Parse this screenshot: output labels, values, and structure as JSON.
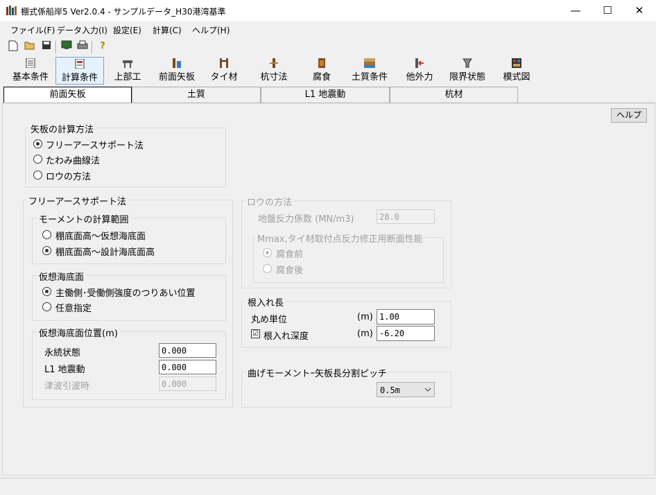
{
  "window": {
    "title": "棚式係船岸5 Ver2.0.4 - サンプルデータ_H30港湾基準",
    "minimize": "—",
    "maximize": "☐",
    "close": "✕"
  },
  "menu": [
    "ファイル(F)",
    "データ入力(I)",
    "設定(E)",
    "計算(C)",
    "ヘルプ(H)"
  ],
  "big_toolbar": [
    "基本条件",
    "計算条件",
    "上部工",
    "前面矢板",
    "タイ材",
    "杭寸法",
    "腐食",
    "土質条件",
    "他外力",
    "限界状態",
    "模式図"
  ],
  "tabs": [
    "前面矢板",
    "土質",
    "L1 地震動",
    "杭材"
  ],
  "help_button": "ヘルプ",
  "calc_method": {
    "legend": "矢板の計算方法",
    "options": [
      "フリーアースサポート法",
      "たわみ曲線法",
      "ロウの方法"
    ],
    "selected": 0
  },
  "free_earth": {
    "legend": "フリーアースサポート法",
    "moment_range": {
      "legend": "モーメントの計算範囲",
      "options": [
        "棚底面高～仮想海底面",
        "棚底面高～設計海底面高"
      ],
      "selected": 1
    },
    "virtual_seabed": {
      "legend": "仮想海底面",
      "options": [
        "主働側･受働側強度のつりあい位置",
        "任意指定"
      ],
      "selected": 0
    },
    "seabed_position": {
      "legend": "仮想海底面位置(m)",
      "rows": [
        {
          "label": "永続状態",
          "value": "0.000"
        },
        {
          "label": "L1 地震動",
          "value": "0.000"
        },
        {
          "label": "津波引波時",
          "value": "0.000"
        }
      ]
    }
  },
  "rowe": {
    "legend": "ロウの方法",
    "reaction_label": "地盤反力係数 (MN/m3)",
    "reaction_value": "28.0",
    "section": {
      "legend": "Mmax,タイ材取付点反力修正用断面性能",
      "options": [
        "腐食前",
        "腐食後"
      ],
      "selected": 0
    }
  },
  "embed": {
    "legend": "根入れ長",
    "round_label": "丸め単位",
    "round_unit": "(m)",
    "round_value": "1.00",
    "depth_label": "根入れ深度",
    "depth_unit": "(m)",
    "depth_value": "-6.20",
    "depth_checked": "☑"
  },
  "pitch": {
    "legend": "曲げモーメントｰ矢板長分割ピッチ",
    "value": "0.5m"
  }
}
